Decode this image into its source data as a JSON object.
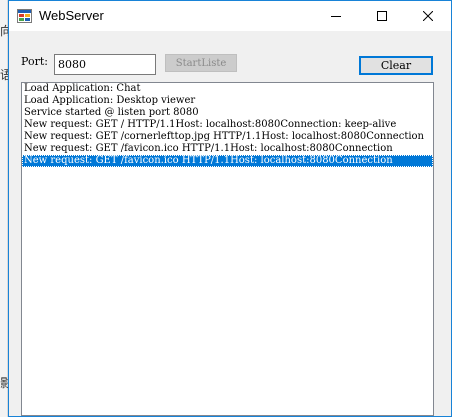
{
  "window": {
    "title": "WebServer",
    "icons": {
      "app": "webserver-app-icon",
      "minimize": "minimize-icon",
      "maximize": "maximize-icon",
      "close": "close-icon"
    },
    "accent_color": "#0078d7",
    "border_color": "#1883d7"
  },
  "toolbar": {
    "port_label": "Port:",
    "port_value": "8080",
    "start_label": "StartListe",
    "clear_label": "Clear"
  },
  "log": {
    "lines": [
      "Load Application: Chat",
      "Load Application: Desktop viewer",
      "Service started @ listen port 8080",
      "New request: GET / HTTP/1.1Host: localhost:8080Connection: keep-alive",
      "New request: GET /cornerlefttop.jpg HTTP/1.1Host: localhost:8080Connection",
      "New request: GET /favicon.ico HTTP/1.1Host: localhost:8080Connection",
      "New request: GET /favicon.ico HTTP/1.1Host: localhost:8080Connection"
    ],
    "selected_index": 6,
    "selection_color": "#0078d7"
  },
  "background": {
    "fragments": [
      "向",
      "语",
      "影"
    ]
  }
}
